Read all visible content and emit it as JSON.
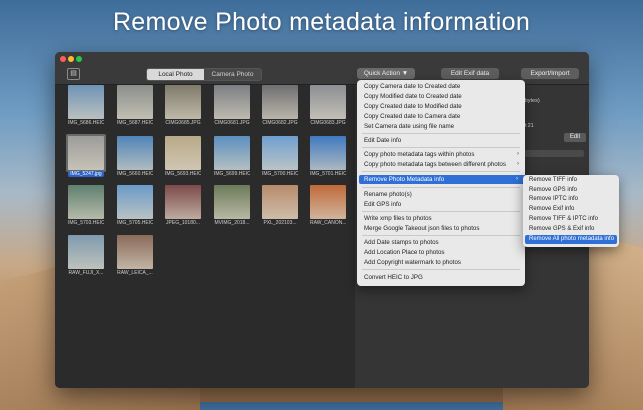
{
  "headline": "Remove Photo metadata information",
  "toolbar": {
    "tabs": [
      "Local Photo",
      "Camera Photo"
    ],
    "quick_action": "Quick Action ▼",
    "edit_exif": "Edit Exif data",
    "export_import": "Export/Import"
  },
  "photos": [
    {
      "name": "IMG_5686.HEIC",
      "color": "#6f93b6"
    },
    {
      "name": "IMG_5687.HEIC",
      "color": "#8a8f8c"
    },
    {
      "name": "CIMG0685.JPG",
      "color": "#7f7a6b"
    },
    {
      "name": "CIMG0681.JPG",
      "color": "#7c7f83"
    },
    {
      "name": "CIMG0682.JPG",
      "color": "#6e6f70"
    },
    {
      "name": "CIMG0683.JPG",
      "color": "#8c8f94"
    },
    {
      "name": "IMG_5247.jpg",
      "color": "#9c9c9a"
    },
    {
      "name": "IMG_5660.HEIC",
      "color": "#4f84b8"
    },
    {
      "name": "IMG_5693.HEIC",
      "color": "#b9a98a"
    },
    {
      "name": "IMG_5699.HEIC",
      "color": "#5c8fbf"
    },
    {
      "name": "IMG_5700.HEIC",
      "color": "#6f9fd0"
    },
    {
      "name": "IMG_5701.HEIC",
      "color": "#3f79c0"
    },
    {
      "name": "IMG_5703.HEIC",
      "color": "#5f7f6f"
    },
    {
      "name": "IMG_5705.HEIC",
      "color": "#6b9ac7"
    },
    {
      "name": "JPEG_10180...",
      "color": "#7c4a4a"
    },
    {
      "name": "MVIMG_2018...",
      "color": "#6b7a5a"
    },
    {
      "name": "PXL_202103...",
      "color": "#b88a6c"
    },
    {
      "name": "RAW_CANON...",
      "color": "#c06a3a"
    },
    {
      "name": "RAW_FUJI_X...",
      "color": "#7f9aae"
    },
    {
      "name": "RAW_LEICA_...",
      "color": "#8b6a5a"
    }
  ],
  "info": {
    "line1": "621 bytes)",
    "line2": "9:21",
    "edit": "Edit"
  },
  "menu": [
    {
      "label": "Copy Camera date to Created date"
    },
    {
      "label": "Copy Modified date to Created date"
    },
    {
      "label": "Copy Created date to Modified date"
    },
    {
      "label": "Copy Created date to Camera date"
    },
    {
      "label": "Set Camera date using file name"
    },
    {
      "label": "Edit Date info"
    },
    {
      "label": "Copy photo metadata tags within photos",
      "sub": "›"
    },
    {
      "label": "Copy photo metadata tags between different photos",
      "sub": "›"
    },
    {
      "label": "Remove Photo Metadata info",
      "sub": "›"
    },
    {
      "label": "Rename photo(s)"
    },
    {
      "label": "Edit GPS  info"
    },
    {
      "label": "Write xmp files to photos"
    },
    {
      "label": "Merge Google Takeout json files to photos"
    },
    {
      "label": "Add Date stamps to photos"
    },
    {
      "label": "Add Location Place to photos"
    },
    {
      "label": "Add Copyright watermark to photos"
    },
    {
      "label": "Convert HEIC to JPG"
    }
  ],
  "submenu": [
    "Remove TIFF info",
    "Remove GPS info",
    "Remove IPTC info",
    "Remove Exif info",
    "Remove TIFF & IPTC info",
    "Remove GPS & Exif info",
    "Remove All photo metadata info"
  ]
}
